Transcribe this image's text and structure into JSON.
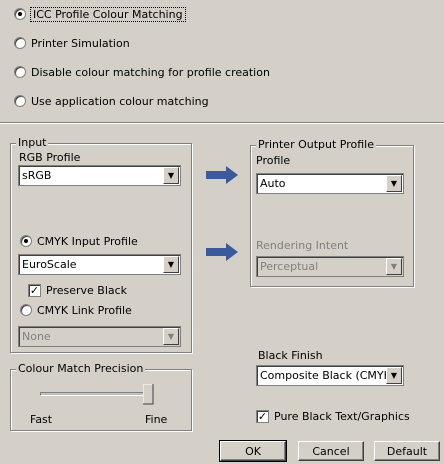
{
  "colour_mode": {
    "options": [
      {
        "label": "ICC Profile Colour Matching",
        "selected": true
      },
      {
        "label": "Printer Simulation",
        "selected": false
      },
      {
        "label": "Disable colour matching for profile creation",
        "selected": false
      },
      {
        "label": "Use application colour matching",
        "selected": false
      }
    ]
  },
  "input_group": {
    "title": "Input",
    "rgb_profile_label": "RGB Profile",
    "rgb_profile_value": "sRGB",
    "cmyk_input_label": "CMYK Input Profile",
    "cmyk_input_selected": true,
    "cmyk_input_value": "EuroScale",
    "preserve_black_label": "Preserve Black",
    "preserve_black_checked": true,
    "cmyk_link_label": "CMYK Link Profile",
    "cmyk_link_selected": false,
    "cmyk_link_value": "None"
  },
  "printer_output_group": {
    "title": "Printer Output Profile",
    "profile_label": "Profile",
    "profile_value": "Auto",
    "rendering_intent_label": "Rendering Intent",
    "rendering_intent_value": "Perceptual"
  },
  "precision_group": {
    "title": "Colour Match Precision",
    "min_label": "Fast",
    "max_label": "Fine",
    "level": 1.0
  },
  "black_finish": {
    "label": "Black Finish",
    "value": "Composite Black (CMYK)"
  },
  "pure_black": {
    "label": "Pure Black Text/Graphics",
    "checked": true
  },
  "buttons": {
    "ok": "OK",
    "cancel": "Cancel",
    "default": "Default"
  },
  "colors": {
    "dialog_bg": "#d4d0c8",
    "arrow": "#3a5a9c",
    "disabled_text": "#808080"
  }
}
